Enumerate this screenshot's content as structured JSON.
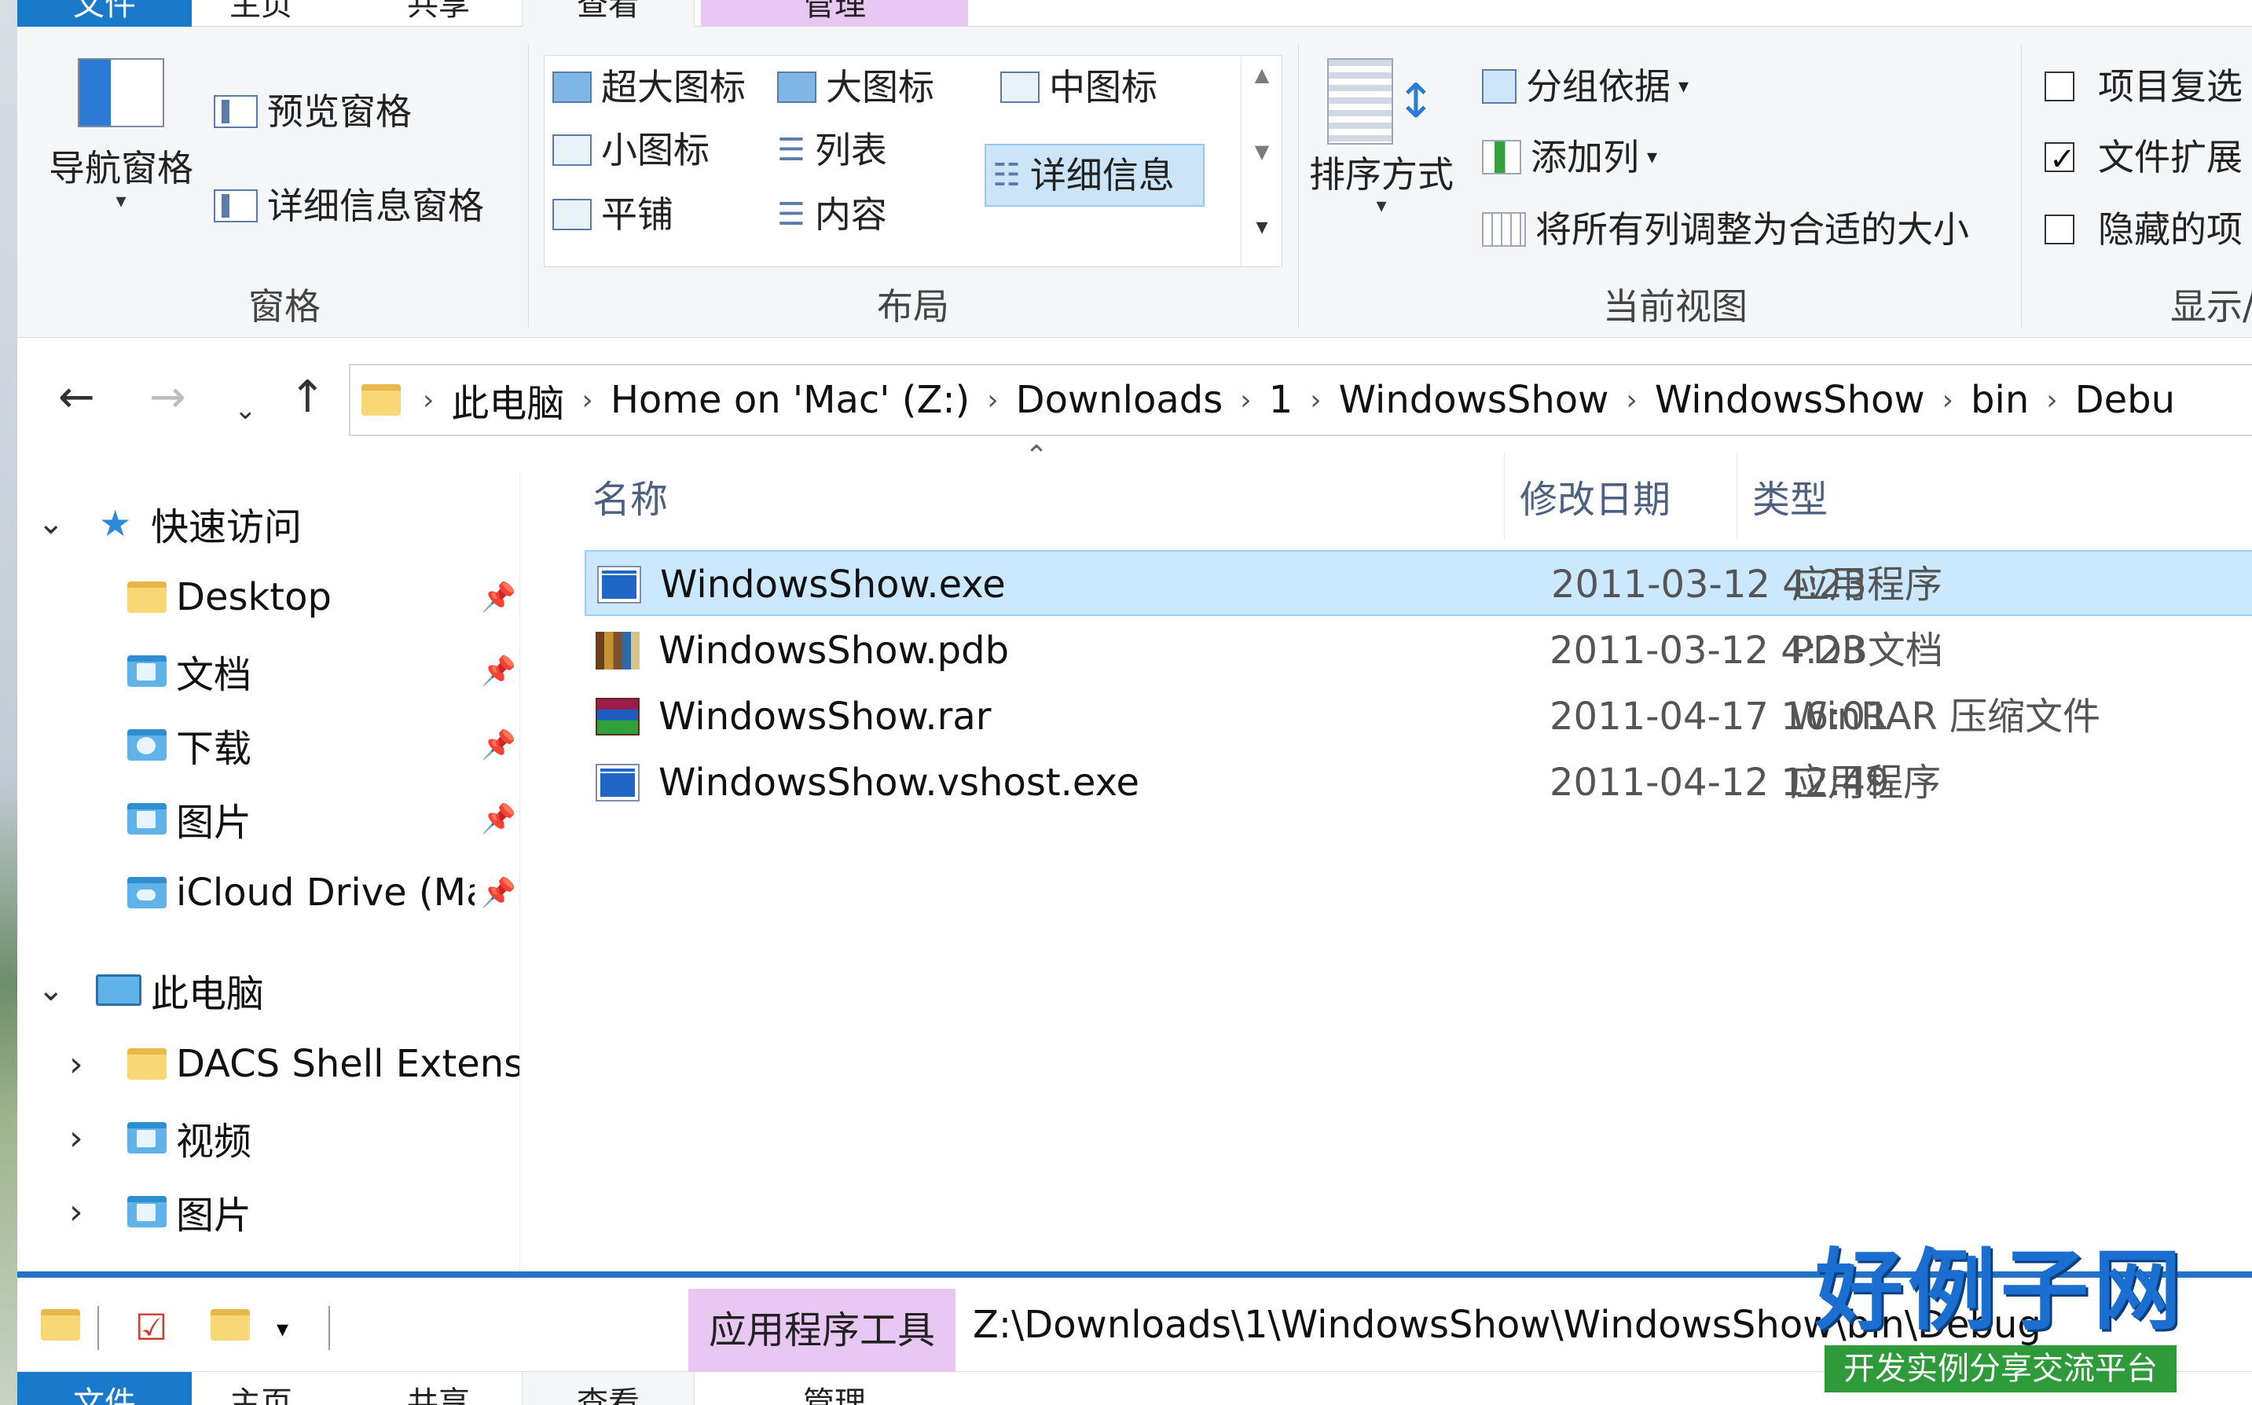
{
  "ribbon_tabs": [
    {
      "label": "文件"
    },
    {
      "label": "主页"
    },
    {
      "label": "共享"
    },
    {
      "label": "查看"
    },
    {
      "label": "管理"
    }
  ],
  "ribbon": {
    "panes": {
      "nav_pane": "导航窗格",
      "preview_pane": "预览窗格",
      "details_pane": "详细信息窗格",
      "label": "窗格"
    },
    "layout": {
      "extra_large": "超大图标",
      "large": "大图标",
      "medium": "中图标",
      "small": "小图标",
      "list": "列表",
      "details": "详细信息",
      "tiles": "平铺",
      "content": "内容",
      "label": "布局"
    },
    "current_view": {
      "sort_by": "排序方式",
      "group_by": "分组依据",
      "add_columns": "添加列",
      "size_all_columns": "将所有列调整为合适的大小",
      "label": "当前视图"
    },
    "show_hide": {
      "item_checkboxes": "项目复选",
      "file_extensions": "文件扩展",
      "hidden_items": "隐藏的项",
      "label": "显示/",
      "item_checkboxes_checked": false,
      "file_extensions_checked": true,
      "hidden_items_checked": false
    }
  },
  "address": {
    "crumbs": [
      "此电脑",
      "Home on 'Mac' (Z:)",
      "Downloads",
      "1",
      "WindowsShow",
      "WindowsShow",
      "bin",
      "Debu"
    ]
  },
  "nav_tree": {
    "quick_access": "快速访问",
    "items": [
      {
        "label": "Desktop"
      },
      {
        "label": "文档"
      },
      {
        "label": "下载"
      },
      {
        "label": "图片"
      },
      {
        "label": "iCloud Drive (Ma"
      }
    ],
    "this_pc": "此电脑",
    "pc_items": [
      {
        "label": "DACS Shell Extensi"
      },
      {
        "label": "视频"
      },
      {
        "label": "图片"
      }
    ]
  },
  "columns": {
    "name": "名称",
    "modified": "修改日期",
    "type": "类型"
  },
  "files": [
    {
      "name": "WindowsShow.exe",
      "date": "2011-03-12 4:23",
      "type": "应用程序",
      "icon": "exe-icon"
    },
    {
      "name": "WindowsShow.pdb",
      "date": "2011-03-12 4:23",
      "type": "PDB文档",
      "icon": "pdb-icon"
    },
    {
      "name": "WindowsShow.rar",
      "date": "2011-04-17 16:01",
      "type": "WinRAR 压缩文件",
      "icon": "rar-icon"
    },
    {
      "name": "WindowsShow.vshost.exe",
      "date": "2011-04-12 12:49",
      "type": "应用程序",
      "icon": "exe-icon"
    }
  ],
  "second_window": {
    "context_tab": "应用程序工具",
    "title_path": "Z:\\Downloads\\1\\WindowsShow\\WindowsShow\\bin\\Debug",
    "tabs": [
      {
        "label": "文件"
      },
      {
        "label": "主页"
      },
      {
        "label": "共享"
      },
      {
        "label": "查看"
      },
      {
        "label": "管理"
      }
    ]
  },
  "watermark": {
    "title": "好例子网",
    "subtitle": "开发实例分享交流平台"
  },
  "colors": {
    "accent": "#1979ca",
    "selection": "#cce8ff",
    "column_header": "#4d6082",
    "context_tab": "#e8c7f3"
  }
}
